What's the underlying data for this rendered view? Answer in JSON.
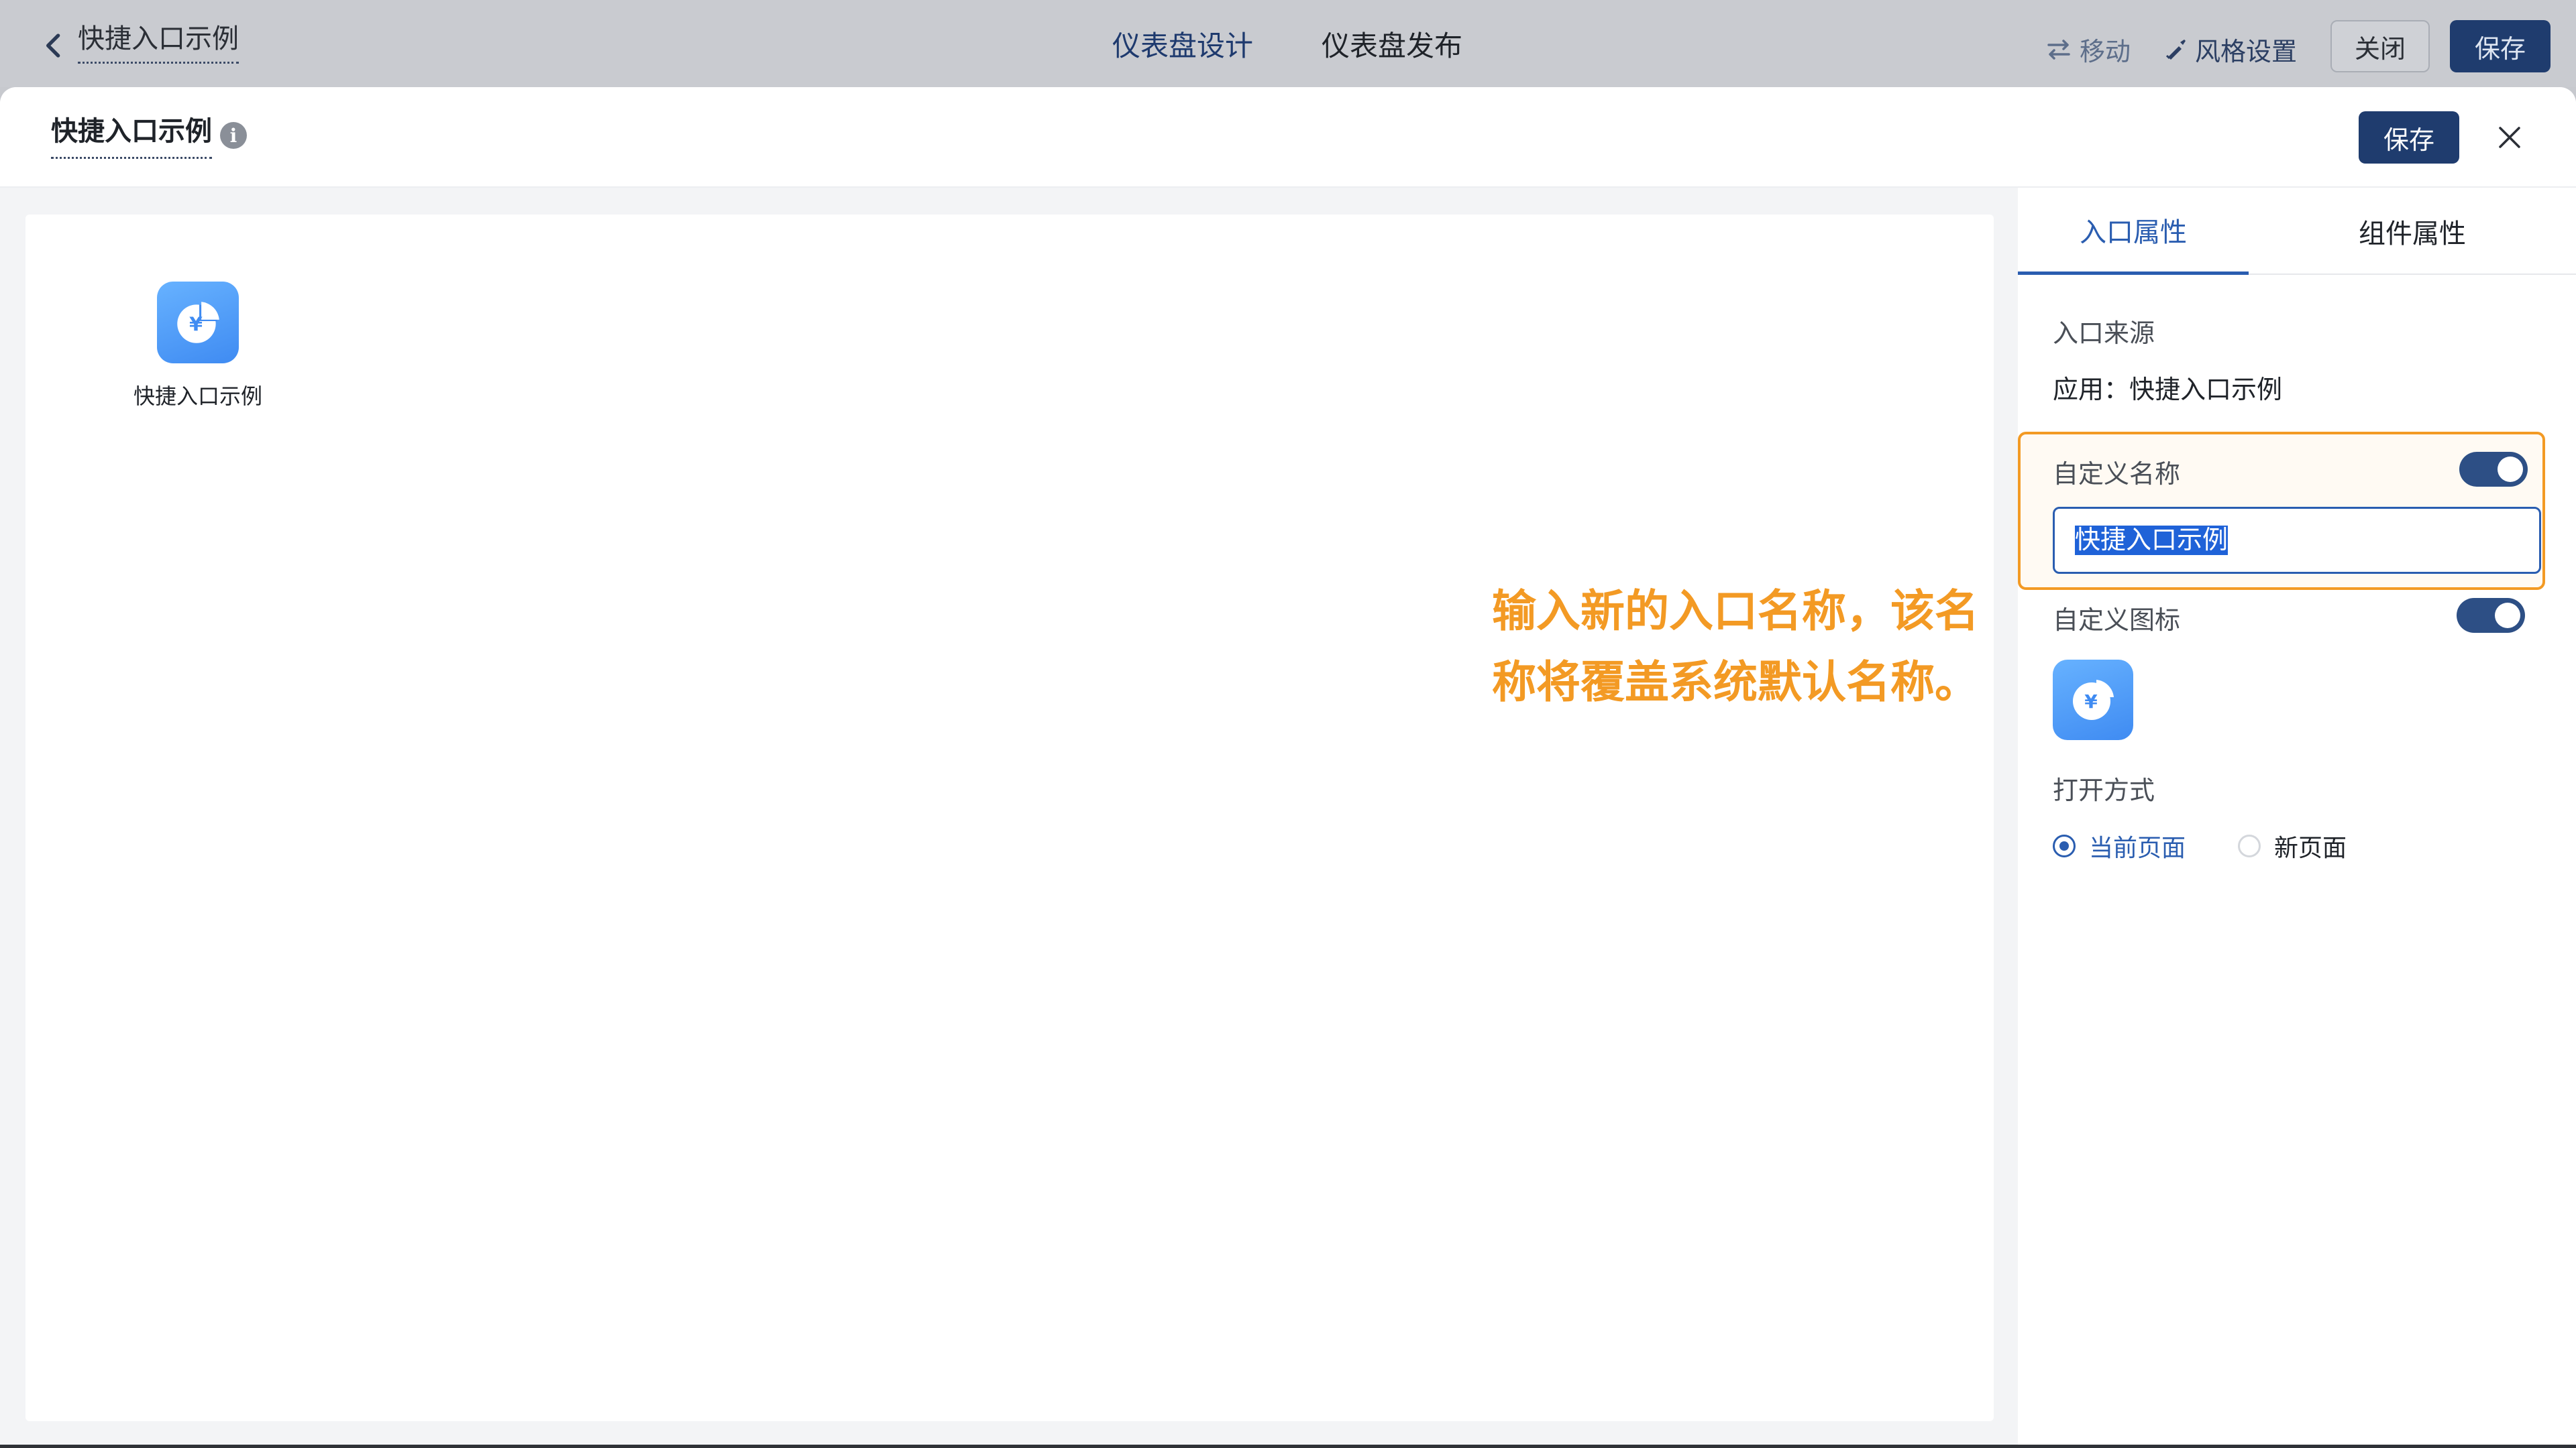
{
  "topbar": {
    "back_icon": "chevron-left-icon",
    "title": "快捷入口示例",
    "tabs": [
      "仪表盘设计",
      "仪表盘发布"
    ],
    "move_label": "移动",
    "move_icon": "swap-arrows-icon",
    "style_label": "风格设置",
    "style_icon": "brush-icon",
    "close_label": "关闭",
    "save_label": "保存"
  },
  "modal": {
    "title": "快捷入口示例",
    "info_icon": "info-icon",
    "info_glyph": "i",
    "save_label": "保存",
    "close_icon": "close-icon"
  },
  "canvas": {
    "entry": {
      "label": "快捷入口示例",
      "icon": "yuan-pie-chart-icon"
    },
    "annotation": {
      "line1": "输入新的入口名称，该名",
      "line2": "称将覆盖系统默认名称。",
      "color": "#f39a24"
    }
  },
  "panel": {
    "tabs": [
      "入口属性",
      "组件属性"
    ],
    "active_tab": "入口属性",
    "source_label": "入口来源",
    "source_value": "应用：快捷入口示例",
    "custom_name_label": "自定义名称",
    "custom_name_enabled": true,
    "custom_name_value": "快捷入口示例",
    "custom_icon_label": "自定义图标",
    "custom_icon_enabled": true,
    "open_mode_label": "打开方式",
    "open_mode_options": [
      "当前页面",
      "新页面"
    ],
    "open_mode_selected": "当前页面"
  },
  "colors": {
    "primary": "#1f3c6e",
    "accent": "#2a5db0",
    "highlight": "#f39a24"
  }
}
